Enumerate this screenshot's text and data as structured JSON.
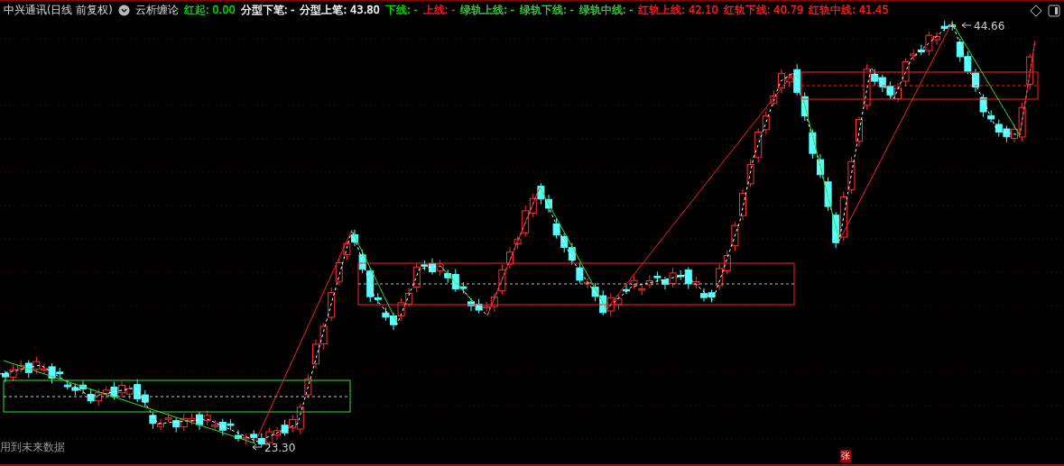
{
  "header": {
    "title": "中兴通讯(日线 前复权)",
    "indicator": "云析缠论",
    "legend": [
      {
        "label": "红起: 0.00",
        "color": "#00e000"
      },
      {
        "label": "分型下笔: -",
        "color": "#ffffff"
      },
      {
        "label": "分型上笔: 43.80",
        "color": "#ffffff"
      },
      {
        "label": "下线: -",
        "color": "#00e000"
      },
      {
        "label": "上线: -",
        "color": "#ff2020"
      },
      {
        "label": "绿轨上线: -",
        "color": "#40d040"
      },
      {
        "label": "绿轨下线: -",
        "color": "#40d040"
      },
      {
        "label": "绿轨中线: -",
        "color": "#40d040"
      },
      {
        "label": "红轨上线: 42.10",
        "color": "#ff2020"
      },
      {
        "label": "红轨下线: 40.79",
        "color": "#ff2020"
      },
      {
        "label": "红轨中线: 41.45",
        "color": "#ff2020"
      }
    ]
  },
  "chart": {
    "high_label": "44.66",
    "low_label": "23.30",
    "note": "用到未来数据",
    "badge": "张"
  }
}
